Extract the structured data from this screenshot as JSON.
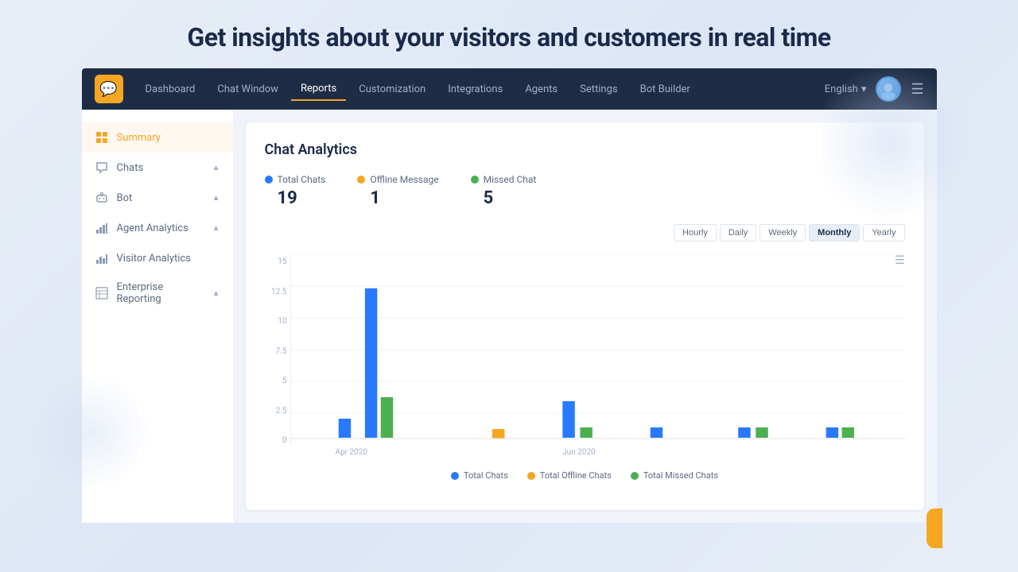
{
  "hero": {
    "text": "Get insights about your visitors and customers in real time"
  },
  "nav": {
    "items": [
      {
        "id": "dashboard",
        "label": "Dashboard",
        "active": false
      },
      {
        "id": "chat-window",
        "label": "Chat Window",
        "active": false
      },
      {
        "id": "reports",
        "label": "Reports",
        "active": true
      },
      {
        "id": "customization",
        "label": "Customization",
        "active": false
      },
      {
        "id": "integrations",
        "label": "Integrations",
        "active": false
      },
      {
        "id": "agents",
        "label": "Agents",
        "active": false
      },
      {
        "id": "settings",
        "label": "Settings",
        "active": false
      },
      {
        "id": "bot-builder",
        "label": "Bot Builder",
        "active": false
      }
    ],
    "language": "English",
    "language_chevron": "▾"
  },
  "sidebar": {
    "items": [
      {
        "id": "summary",
        "label": "Summary",
        "active": true,
        "icon": "summary"
      },
      {
        "id": "chats",
        "label": "Chats",
        "active": false,
        "icon": "chats",
        "expandable": true
      },
      {
        "id": "bot",
        "label": "Bot",
        "active": false,
        "icon": "bot",
        "expandable": true
      },
      {
        "id": "agent-analytics",
        "label": "Agent Analytics",
        "active": false,
        "icon": "analytics",
        "expandable": true
      },
      {
        "id": "visitor-analytics",
        "label": "Visitor Analytics",
        "active": false,
        "icon": "visitor"
      },
      {
        "id": "enterprise-reporting",
        "label": "Enterprise Reporting",
        "active": false,
        "icon": "enterprise",
        "expandable": true
      }
    ]
  },
  "panel": {
    "title": "Chat Analytics",
    "stats": [
      {
        "id": "total-chats",
        "label": "Total Chats",
        "value": "19",
        "color": "#2979ff"
      },
      {
        "id": "offline-message",
        "label": "Offline Message",
        "value": "1",
        "color": "#f5a623"
      },
      {
        "id": "missed-chat",
        "label": "Missed Chat",
        "value": "5",
        "color": "#4caf50"
      }
    ],
    "time_filters": [
      {
        "id": "hourly",
        "label": "Hourly",
        "active": false
      },
      {
        "id": "daily",
        "label": "Daily",
        "active": false
      },
      {
        "id": "weekly",
        "label": "Weekly",
        "active": false
      },
      {
        "id": "monthly",
        "label": "Monthly",
        "active": true
      },
      {
        "id": "yearly",
        "label": "Yearly",
        "active": false
      }
    ],
    "chart": {
      "y_labels": [
        "15",
        "12.5",
        "10",
        "7.5",
        "5",
        "2.5",
        "0"
      ],
      "x_labels": [
        {
          "label": "Apr 2020",
          "position": "15%"
        },
        {
          "label": "Jun 2020",
          "position": "58%"
        }
      ],
      "bars": [
        {
          "x": 8,
          "color": "#2979ff",
          "height_pct": 14,
          "group": "apr"
        },
        {
          "x": 16,
          "color": "#2979ff",
          "height_pct": 82,
          "group": "apr2"
        },
        {
          "x": 24,
          "color": "#4caf50",
          "height_pct": 26,
          "group": "apr3"
        },
        {
          "x": 42,
          "color": "#f5a623",
          "height_pct": 8,
          "group": "may"
        },
        {
          "x": 53,
          "color": "#2979ff",
          "height_pct": 22,
          "group": "jun"
        },
        {
          "x": 60,
          "color": "#4caf50",
          "height_pct": 8,
          "group": "jun2"
        },
        {
          "x": 70,
          "color": "#2979ff",
          "height_pct": 8,
          "group": "jul"
        },
        {
          "x": 82,
          "color": "#2979ff",
          "height_pct": 8,
          "group": "aug"
        },
        {
          "x": 90,
          "color": "#4caf50",
          "height_pct": 8,
          "group": "aug2"
        }
      ]
    },
    "legend": [
      {
        "id": "total-chats",
        "label": "Total Chats",
        "color": "#2979ff"
      },
      {
        "id": "total-offline",
        "label": "Total Offline Chats",
        "color": "#f5a623"
      },
      {
        "id": "total-missed",
        "label": "Total Missed Chats",
        "color": "#4caf50"
      }
    ]
  }
}
